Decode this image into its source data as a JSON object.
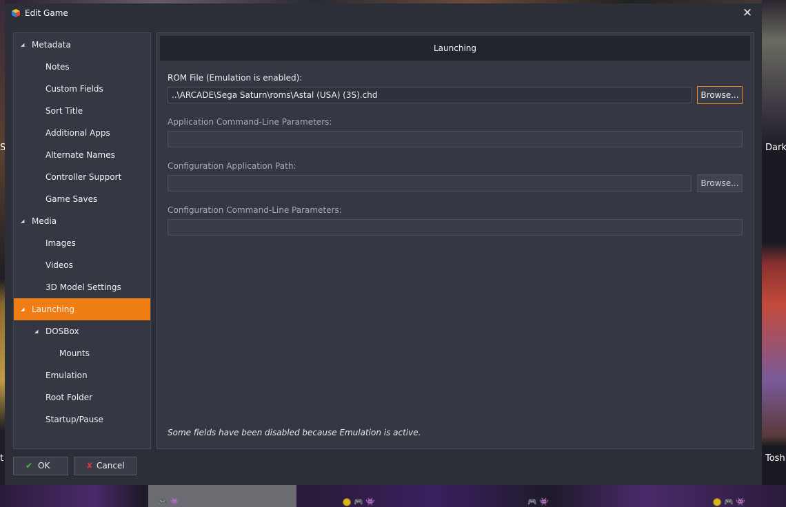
{
  "window": {
    "title": "Edit Game",
    "close_symbol": "✕"
  },
  "tree": {
    "items": [
      {
        "label": "Metadata",
        "expanded": true
      },
      {
        "label": "Notes"
      },
      {
        "label": "Custom Fields"
      },
      {
        "label": "Sort Title"
      },
      {
        "label": "Additional Apps"
      },
      {
        "label": "Alternate Names"
      },
      {
        "label": "Controller Support"
      },
      {
        "label": "Game Saves"
      },
      {
        "label": "Media",
        "expanded": true
      },
      {
        "label": "Images"
      },
      {
        "label": "Videos"
      },
      {
        "label": "3D Model Settings"
      },
      {
        "label": "Launching",
        "expanded": true,
        "selected": true
      },
      {
        "label": "DOSBox",
        "expanded": true
      },
      {
        "label": "Mounts"
      },
      {
        "label": "Emulation"
      },
      {
        "label": "Root Folder"
      },
      {
        "label": "Startup/Pause"
      }
    ]
  },
  "launching": {
    "header": "Launching",
    "rom_file_label": "ROM File (Emulation is enabled):",
    "rom_file_value": "..\\ARCADE\\Sega Saturn\\roms\\Astal (USA) (3S).chd",
    "browse_label": "Browse...",
    "app_params_label": "Application Command-Line Parameters:",
    "app_params_value": "",
    "config_path_label": "Configuration Application Path:",
    "config_path_value": "",
    "config_browse_label": "Browse...",
    "config_params_label": "Configuration Command-Line Parameters:",
    "config_params_value": "",
    "note": "Some fields have been disabled because Emulation is active."
  },
  "buttons": {
    "ok_label": "OK",
    "cancel_label": "Cancel"
  },
  "background": {
    "right_labels": [
      "Darks",
      "Toshi"
    ],
    "left_labels": [
      "Sa",
      "t"
    ]
  },
  "colors": {
    "accent": "#f07d14",
    "dialog_bg": "#2c2e38",
    "panel_bg": "#353742",
    "ok_icon": "#3fbf3f",
    "cancel_icon": "#d03a3a"
  },
  "icons": {
    "app": "launchbox-cube-icon",
    "ok": "checkmark-icon",
    "cancel": "x-icon",
    "expand": "expanded-triangle-icon"
  }
}
